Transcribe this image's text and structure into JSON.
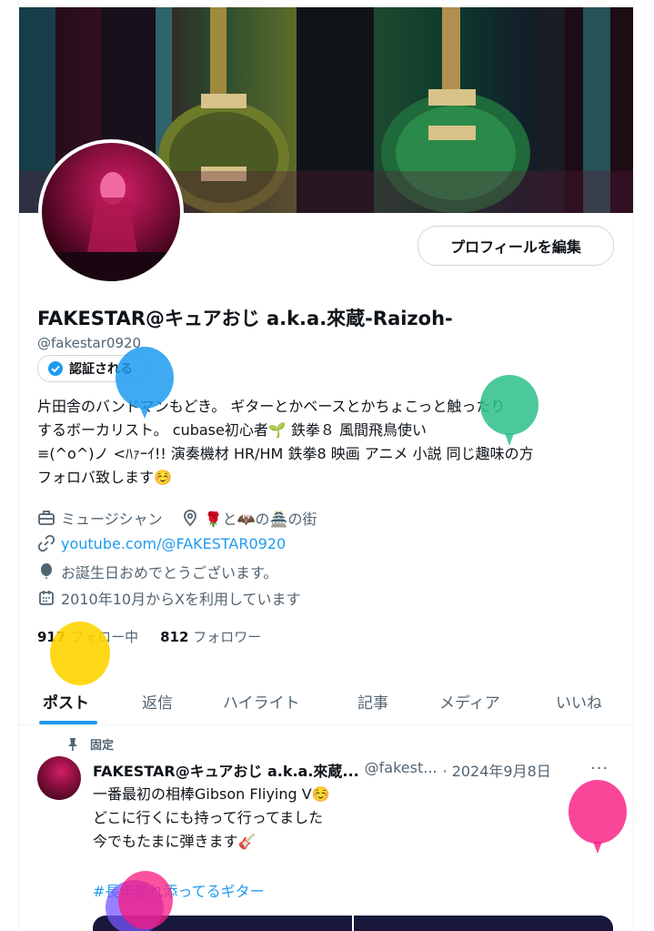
{
  "profile": {
    "edit_button": "プロフィールを編集",
    "display_name": "FAKESTAR@キュアおじ a.k.a.來蔵-Raizoh-",
    "handle": "@fakestar0920",
    "verified_label": "認証される",
    "bio": [
      "片田舎のバンドマンもどき。 ギターとかベースとかちょこっと触ったり",
      "するボーカリスト。 cubase初心者🌱 鉄拳８ 風間飛鳥使い",
      "≡(^o^)ノ <ﾊｧｰｲ!! 演奏機材 HR/HM 鉄拳8 映画 アニメ 小説 同じ趣味の方",
      "フォロバ致します☺️"
    ],
    "category": "ミュージシャン",
    "location": "🌹と🦇の🏯の街",
    "website": "youtube.com/@FAKESTAR0920",
    "birthday": "お誕生日おめでとうございます。",
    "joined": "2010年10月からXを利用しています",
    "following_count": "917",
    "following_label": "フォロー中",
    "followers_count": "812",
    "followers_label": "フォロワー"
  },
  "tabs": [
    {
      "label": "ポスト"
    },
    {
      "label": "返信"
    },
    {
      "label": "ハイライト"
    },
    {
      "label": "記事"
    },
    {
      "label": "メディア"
    },
    {
      "label": "いいね"
    }
  ],
  "post": {
    "pinned_label": "固定",
    "author": "FAKESTAR@キュアおじ a.k.a.來蔵...",
    "handle": "@fakest...",
    "date": "· 2024年9月8日",
    "more": "···",
    "lines": [
      "一番最初の相棒Gibson Fliying V☺️",
      "どこに行くにも持って行ってました",
      "今でもたまに弾きます🎸"
    ],
    "hashtag": "#長年連れ添ってるギター"
  },
  "colors": {
    "accent": "#1d9bf0",
    "text": "#0f1419",
    "secondary": "#536471"
  },
  "icons": [
    "briefcase-icon",
    "location-pin-icon",
    "link-icon",
    "balloon-icon",
    "calendar-icon",
    "pin-icon",
    "verified-badge-icon"
  ]
}
